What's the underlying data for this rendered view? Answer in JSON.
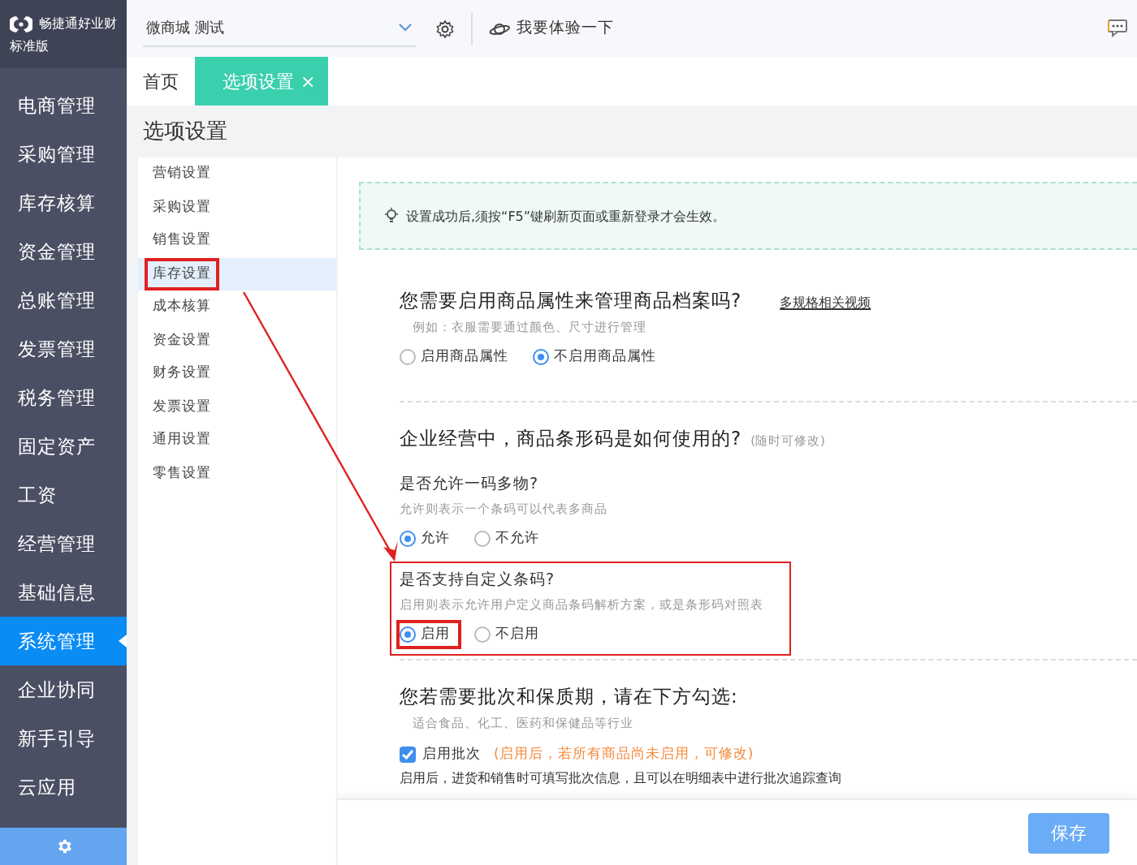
{
  "brand": {
    "name": "畅捷通好业财",
    "edition": "标准版"
  },
  "sidebar": {
    "items": [
      {
        "label": "电商管理",
        "selected": false
      },
      {
        "label": "采购管理",
        "selected": false
      },
      {
        "label": "库存核算",
        "selected": false
      },
      {
        "label": "资金管理",
        "selected": false
      },
      {
        "label": "总账管理",
        "selected": false
      },
      {
        "label": "发票管理",
        "selected": false
      },
      {
        "label": "税务管理",
        "selected": false
      },
      {
        "label": "固定资产",
        "selected": false
      },
      {
        "label": "工资",
        "selected": false
      },
      {
        "label": "经营管理",
        "selected": false
      },
      {
        "label": "基础信息",
        "selected": false
      },
      {
        "label": "系统管理",
        "selected": true
      },
      {
        "label": "企业协同",
        "selected": false
      },
      {
        "label": "新手引导",
        "selected": false
      },
      {
        "label": "云应用",
        "selected": false
      }
    ]
  },
  "topbar": {
    "account": "微商城 测试",
    "try_link": "我要体验一下"
  },
  "tabs": [
    {
      "label": "首页",
      "selected": false
    },
    {
      "label": "选项设置",
      "selected": true,
      "close": "×"
    }
  ],
  "page_title": "选项设置",
  "settings_menu": [
    {
      "label": "营销设置",
      "selected": false,
      "highlighted": false
    },
    {
      "label": "采购设置",
      "selected": false,
      "highlighted": false
    },
    {
      "label": "销售设置",
      "selected": false,
      "highlighted": false
    },
    {
      "label": "库存设置",
      "selected": true,
      "highlighted": true
    },
    {
      "label": "成本核算",
      "selected": false,
      "highlighted": false
    },
    {
      "label": "资金设置",
      "selected": false,
      "highlighted": false
    },
    {
      "label": "财务设置",
      "selected": false,
      "highlighted": false
    },
    {
      "label": "发票设置",
      "selected": false,
      "highlighted": false
    },
    {
      "label": "通用设置",
      "selected": false,
      "highlighted": false
    },
    {
      "label": "零售设置",
      "selected": false,
      "highlighted": false
    }
  ],
  "tip": "设置成功后,须按“F5”键刷新页面或重新登录才会生效。",
  "sections": [
    {
      "title": "您需要启用商品属性来管理商品档案吗?",
      "link": "多规格相关视频",
      "hint": "例如：衣服需要通过颜色、尺寸进行管理",
      "options": [
        {
          "label": "启用商品属性",
          "selected": false
        },
        {
          "label": "不启用商品属性",
          "selected": true
        }
      ]
    },
    {
      "title": "企业经营中，商品条形码是如何使用的?",
      "note": "(随时可修改)",
      "questions": [
        {
          "title": "是否允许一码多物?",
          "hint": "允许则表示一个条码可以代表多商品",
          "highlighted": false,
          "options": [
            {
              "label": "允许",
              "selected": true
            },
            {
              "label": "不允许",
              "selected": false
            }
          ]
        },
        {
          "title": "是否支持自定义条码?",
          "hint": "启用则表示允许用户定义商品条码解析方案，或是条形码对照表",
          "highlighted": true,
          "options": [
            {
              "label": "启用",
              "selected": true
            },
            {
              "label": "不启用",
              "selected": false
            }
          ]
        }
      ]
    },
    {
      "title": "您若需要批次和保质期，请在下方勾选:",
      "hint": "适合食品、化工、医药和保健品等行业",
      "checkbox": {
        "label": "启用批次",
        "checked": true,
        "note": "(启用后，若所有商品尚未启用，可修改)"
      },
      "description": "启用后，进货和销售时可填写批次信息，且可以在明细表中进行批次追踪查询"
    }
  ],
  "save_button": "保存"
}
